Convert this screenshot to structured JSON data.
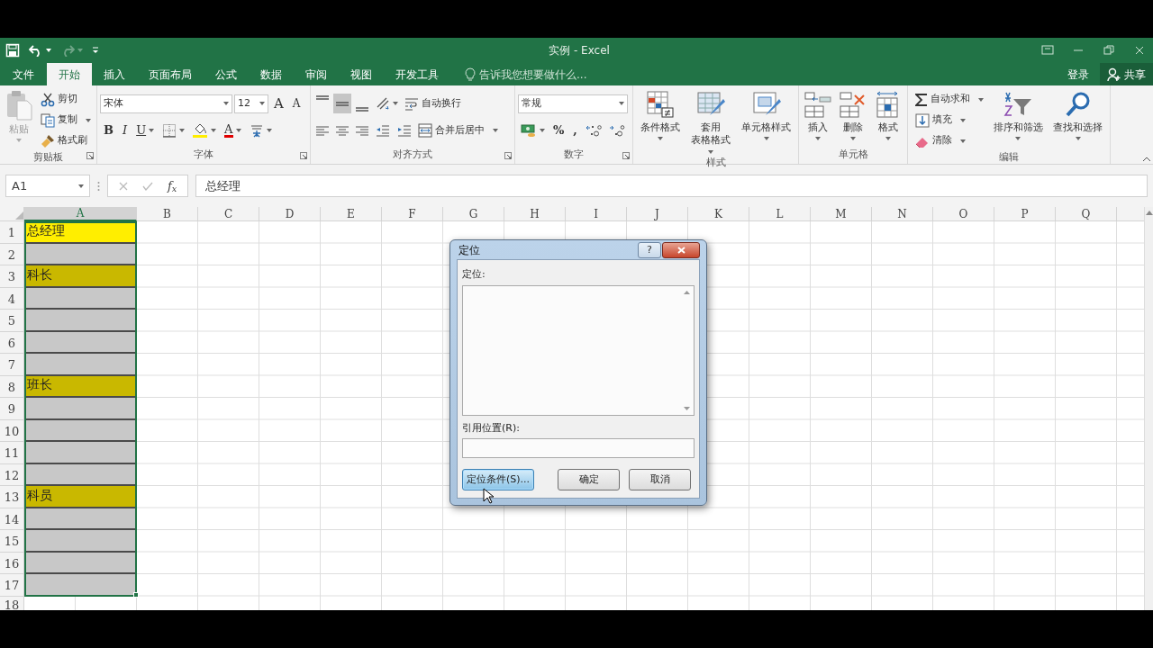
{
  "window": {
    "title": "实例 - Excel"
  },
  "quick_access": [
    {
      "kind": "save",
      "dropdown": false,
      "disabled": false
    },
    {
      "kind": "undo",
      "dropdown": true,
      "disabled": false
    },
    {
      "kind": "redo",
      "dropdown": true,
      "disabled": true
    },
    {
      "kind": "customize",
      "dropdown": false,
      "disabled": false
    }
  ],
  "tabs": [
    {
      "label": "文件",
      "selected": false
    },
    {
      "label": "开始",
      "selected": true
    },
    {
      "label": "插入",
      "selected": false
    },
    {
      "label": "页面布局",
      "selected": false
    },
    {
      "label": "公式",
      "selected": false
    },
    {
      "label": "数据",
      "selected": false
    },
    {
      "label": "审阅",
      "selected": false
    },
    {
      "label": "视图",
      "selected": false
    },
    {
      "label": "开发工具",
      "selected": false
    }
  ],
  "tell_me": {
    "placeholder": "告诉我您想要做什么..."
  },
  "account": {
    "login": "登录",
    "share": "共享"
  },
  "ribbon": {
    "groups": [
      {
        "label": "剪贴板",
        "launcher": true,
        "columns": [
          [
            {
              "kind": "large",
              "label_lines": [
                "粘贴"
              ],
              "dropdown": true,
              "disabled": true
            }
          ],
          [
            {
              "kind": "small",
              "label": "剪切",
              "dropdown": false
            },
            {
              "kind": "small",
              "label": "复制",
              "dropdown": true
            },
            {
              "kind": "small",
              "label": "格式刷",
              "dropdown": false
            }
          ]
        ]
      },
      {
        "label": "字体",
        "launcher": true,
        "lines": [
          [
            {
              "kind": "combo",
              "value": "宋体"
            },
            {
              "kind": "combo",
              "value": "12"
            },
            {
              "kind": "grow",
              "label": "A"
            },
            {
              "kind": "shrink",
              "label": "A"
            }
          ],
          [
            {
              "kind": "bold",
              "label": "B",
              "selected": false
            },
            {
              "kind": "italic",
              "label": "I",
              "selected": false
            },
            {
              "kind": "underline",
              "label": "U",
              "selected": false,
              "dropdown": true
            },
            {
              "kind": "icon",
              "dropdown": true
            },
            {
              "kind": "icon",
              "dropdown": true
            },
            {
              "kind": "fontcolor",
              "label": "A",
              "dropdown": true
            },
            {
              "kind": "icon",
              "dropdown": true
            }
          ]
        ]
      },
      {
        "label": "对齐方式",
        "launcher": true,
        "lines": [
          [
            {
              "kind": "icon",
              "selected": false
            },
            {
              "kind": "icon",
              "selected": true
            },
            {
              "kind": "icon",
              "selected": false
            },
            {
              "kind": "icon",
              "dropdown": true
            },
            {
              "kind": "small",
              "label": "自动换行",
              "dropdown": false
            }
          ],
          [
            {
              "kind": "icon",
              "selected": false
            },
            {
              "kind": "icon",
              "selected": false
            },
            {
              "kind": "icon",
              "selected": false
            },
            {
              "kind": "icon"
            },
            {
              "kind": "icon"
            },
            {
              "kind": "small",
              "label": "合并后居中",
              "dropdown": true
            }
          ]
        ]
      },
      {
        "label": "数字",
        "launcher": true,
        "lines": [
          [
            {
              "kind": "combo",
              "value": "常规"
            }
          ],
          [
            {
              "kind": "icon",
              "dropdown": true
            },
            {
              "kind": "symbol",
              "label": "%"
            },
            {
              "kind": "symbol",
              "label": ","
            },
            {
              "kind": "icon"
            },
            {
              "kind": "icon"
            }
          ]
        ]
      },
      {
        "label": "样式",
        "launcher": false,
        "columns": [
          [
            {
              "kind": "large",
              "label_lines": [
                "条件格式"
              ],
              "dropdown": true,
              "disabled": false
            }
          ],
          [
            {
              "kind": "large",
              "label_lines": [
                "套用",
                "表格格式"
              ],
              "dropdown": true,
              "disabled": false
            }
          ],
          [
            {
              "kind": "large",
              "label_lines": [
                "单元格样式"
              ],
              "dropdown": true,
              "disabled": false
            }
          ]
        ]
      },
      {
        "label": "单元格",
        "launcher": false,
        "columns": [
          [
            {
              "kind": "large",
              "label_lines": [
                "插入"
              ],
              "dropdown": true,
              "disabled": false
            }
          ],
          [
            {
              "kind": "large",
              "label_lines": [
                "删除"
              ],
              "dropdown": true,
              "disabled": false
            }
          ],
          [
            {
              "kind": "large",
              "label_lines": [
                "格式"
              ],
              "dropdown": true,
              "disabled": false
            }
          ]
        ]
      },
      {
        "label": "编辑",
        "launcher": false,
        "columns": [
          [
            {
              "kind": "small",
              "label": "自动求和",
              "dropdown": true
            },
            {
              "kind": "small",
              "label": "填充",
              "dropdown": true
            },
            {
              "kind": "small",
              "label": "清除",
              "dropdown": true
            }
          ],
          [
            {
              "kind": "large",
              "label_lines": [
                "排序和筛选"
              ],
              "dropdown": true,
              "disabled": false
            }
          ],
          [
            {
              "kind": "large",
              "label_lines": [
                "查找和选择"
              ],
              "dropdown": true,
              "disabled": false
            }
          ]
        ]
      }
    ]
  },
  "formula_bar": {
    "name_box": "A1",
    "function_button": "f$_{x}$",
    "formula": "总经理"
  },
  "columns": [
    {
      "label": "A",
      "selected": true
    },
    {
      "label": "B",
      "selected": false
    },
    {
      "label": "C",
      "selected": false
    },
    {
      "label": "D",
      "selected": false
    },
    {
      "label": "E",
      "selected": false
    },
    {
      "label": "F",
      "selected": false
    },
    {
      "label": "G",
      "selected": false
    },
    {
      "label": "H",
      "selected": false
    },
    {
      "label": "I",
      "selected": false
    },
    {
      "label": "J",
      "selected": false
    },
    {
      "label": "K",
      "selected": false
    },
    {
      "label": "L",
      "selected": false
    },
    {
      "label": "M",
      "selected": false
    },
    {
      "label": "N",
      "selected": false
    },
    {
      "label": "O",
      "selected": false
    },
    {
      "label": "P",
      "selected": false
    },
    {
      "label": "Q",
      "selected": false
    }
  ],
  "rows": [
    {
      "number": "1",
      "value": "总经理",
      "color": "#ffee00"
    },
    {
      "number": "2",
      "color": "#c8c8c8"
    },
    {
      "number": "3",
      "value": "科长",
      "color": "#c9b800"
    },
    {
      "number": "4",
      "color": "#c8c8c8"
    },
    {
      "number": "5",
      "color": "#c8c8c8"
    },
    {
      "number": "6",
      "color": "#c8c8c8"
    },
    {
      "number": "7",
      "color": "#c8c8c8"
    },
    {
      "number": "8",
      "value": "班长",
      "color": "#c9b800"
    },
    {
      "number": "9",
      "color": "#c8c8c8"
    },
    {
      "number": "10",
      "color": "#c8c8c8"
    },
    {
      "number": "11",
      "color": "#c8c8c8"
    },
    {
      "number": "12",
      "color": "#c8c8c8"
    },
    {
      "number": "13",
      "value": "科员",
      "color": "#c9b800"
    },
    {
      "number": "14",
      "color": "#c8c8c8"
    },
    {
      "number": "15",
      "color": "#c8c8c8"
    },
    {
      "number": "16",
      "color": "#c8c8c8"
    },
    {
      "number": "17",
      "color": "#c8c8c8"
    },
    {
      "number": "18"
    }
  ],
  "dialog": {
    "title": "定位",
    "help": "?",
    "list_label": "定位:",
    "reference_label": "引用位置(R):",
    "buttons": [
      {
        "label": "定位条件(S)...",
        "focused": true
      },
      {
        "label": "确定",
        "focused": false
      },
      {
        "label": "取消",
        "focused": false
      }
    ]
  }
}
